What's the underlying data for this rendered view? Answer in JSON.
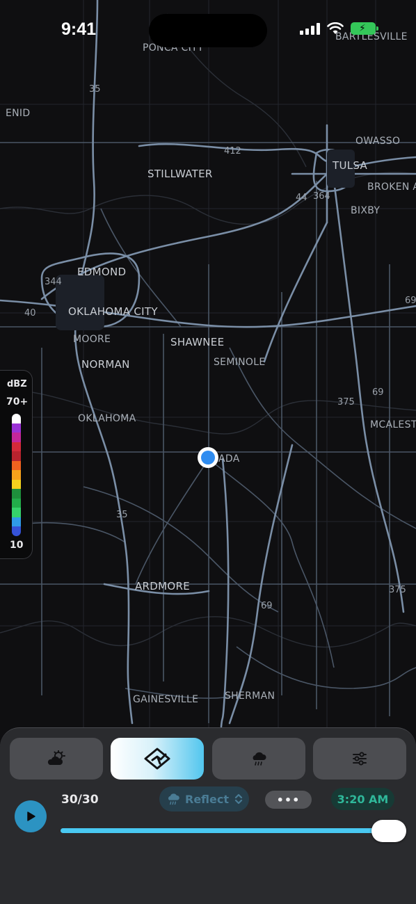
{
  "status_bar": {
    "time": "9:41",
    "battery_state": "charging"
  },
  "map": {
    "city_labels": [
      {
        "text": "PONCA CITY"
      },
      {
        "text": "BARTLESVILLE"
      },
      {
        "text": "ENID"
      },
      {
        "text": "OWASSO"
      },
      {
        "text": "STILLWATER"
      },
      {
        "text": "TULSA"
      },
      {
        "text": "BROKEN AR"
      },
      {
        "text": "BIXBY"
      },
      {
        "text": "EDMOND"
      },
      {
        "text": "OKLAHOMA CITY"
      },
      {
        "text": "MOORE"
      },
      {
        "text": "SHAWNEE"
      },
      {
        "text": "NORMAN"
      },
      {
        "text": "SEMINOLE"
      },
      {
        "text": "OKLAHOMA"
      },
      {
        "text": "MCALESTE"
      },
      {
        "text": "ADA"
      },
      {
        "text": "ARDMORE"
      },
      {
        "text": "GAINESVILLE"
      },
      {
        "text": "SHERMAN"
      }
    ],
    "route_labels": [
      "35",
      "412",
      "44",
      "364",
      "344",
      "40",
      "69",
      "375",
      "69",
      "35",
      "375",
      "69"
    ]
  },
  "legend": {
    "unit": "dBZ",
    "max_label": "70+",
    "min_label": "10",
    "colors": [
      "#ffffff",
      "#9b32d6",
      "#c4279a",
      "#d42a3a",
      "#b8232e",
      "#f0621f",
      "#f7a21b",
      "#f4d21e",
      "#1e8f3c",
      "#22ad4a",
      "#35d36b",
      "#2f9be8",
      "#3552d8"
    ]
  },
  "bottom_panel": {
    "tabs": [
      {
        "icon": "partly-cloudy-icon"
      },
      {
        "icon": "radar-icon"
      },
      {
        "icon": "rain-cloud-icon"
      },
      {
        "icon": "sliders-icon"
      }
    ],
    "active_tab_index": 1,
    "frame_counter": "30/30",
    "product_label": "Reflect",
    "more_label": "•••",
    "timestamp": "3:20 AM",
    "playback_progress": 1.0
  },
  "colors": {
    "accent": "#49c9f2",
    "location_dot": "#2f8cf0",
    "time_pill_text": "#2fb89a"
  }
}
